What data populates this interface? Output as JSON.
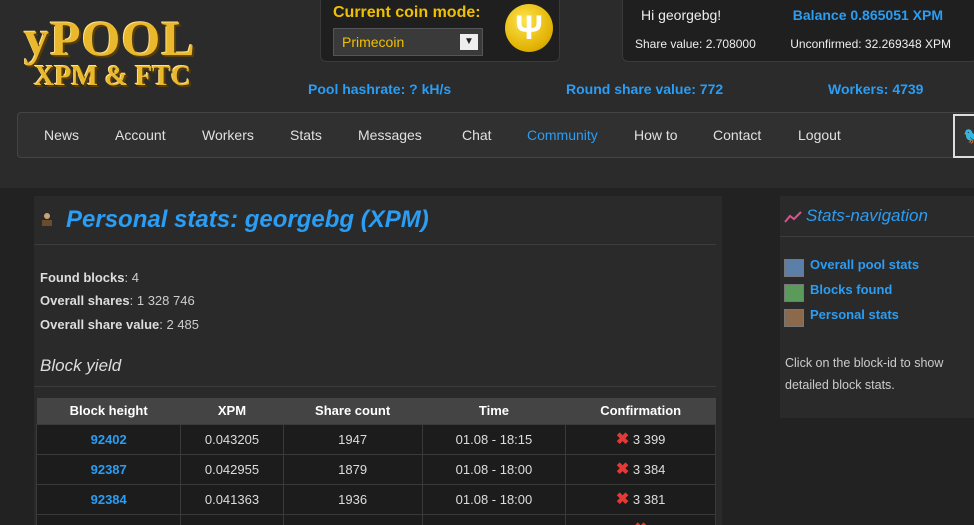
{
  "logo": {
    "line1": "yPOOL",
    "line2": "XPM & FTC"
  },
  "coin": {
    "label": "Current coin mode:",
    "selected": "Primecoin",
    "icon": "primecoin-icon"
  },
  "user": {
    "greeting": "Hi georgebg!",
    "balance": "Balance 0.865051 XPM",
    "share_value": "Share value: 2.708000",
    "unconfirmed": "Unconfirmed: 32.269348 XPM"
  },
  "stats": {
    "hashrate": "Pool hashrate: ? kH/s",
    "round_share": "Round share value: 772",
    "workers": "Workers: 4739"
  },
  "nav": {
    "items": [
      {
        "label": "News"
      },
      {
        "label": "Account"
      },
      {
        "label": "Workers"
      },
      {
        "label": "Stats"
      },
      {
        "label": "Messages"
      },
      {
        "label": "Chat"
      },
      {
        "label": "Community"
      },
      {
        "label": "How to"
      },
      {
        "label": "Contact"
      },
      {
        "label": "Logout"
      }
    ],
    "active": "Community"
  },
  "main": {
    "title": "Personal stats: georgebg (XPM)",
    "found_blocks_label": "Found blocks",
    "found_blocks": ": 4",
    "overall_shares_label": "Overall shares",
    "overall_shares": ": 1 328 746",
    "share_value_label": "Overall share value",
    "share_value": ": 2 485",
    "block_yield": "Block yield"
  },
  "table": {
    "headers": [
      "Block height",
      "XPM",
      "Share count",
      "Time",
      "Confirmation"
    ],
    "rows": [
      {
        "height": "92402",
        "xpm": "0.043205",
        "shares": "1947",
        "time": "01.08 - 18:15",
        "conf": "3 399"
      },
      {
        "height": "92387",
        "xpm": "0.042955",
        "shares": "1879",
        "time": "01.08 - 18:00",
        "conf": "3 384"
      },
      {
        "height": "92384",
        "xpm": "0.041363",
        "shares": "1936",
        "time": "01.08 - 18:00",
        "conf": "3 381"
      }
    ]
  },
  "side": {
    "title": "Stats-navigation",
    "links": [
      "Overall pool stats",
      "Blocks found",
      "Personal stats"
    ],
    "note": "Click on the block-id to show detailed block stats."
  },
  "colors": {
    "accent": "#2a9df4",
    "gold": "#e9b82c",
    "error": "#e53935"
  }
}
